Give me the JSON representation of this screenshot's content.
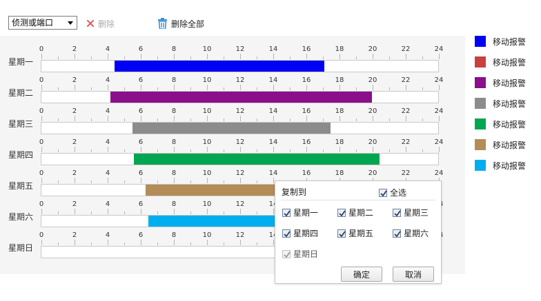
{
  "toolbar": {
    "select_value": "侦测或端口",
    "delete_label": "删除",
    "delete_all_label": "删除全部"
  },
  "axis_ticks": [
    "0",
    "2",
    "4",
    "6",
    "8",
    "10",
    "12",
    "14",
    "16",
    "18",
    "20",
    "22",
    "24"
  ],
  "days": [
    {
      "label": "星期一",
      "start": 4.4,
      "end": 17.1,
      "color": "#0000f5",
      "visible_ticks": 13
    },
    {
      "label": "星期二",
      "start": 4.15,
      "end": 19.95,
      "color": "#8b0e8b",
      "visible_ticks": 13
    },
    {
      "label": "星期三",
      "start": 5.5,
      "end": 17.45,
      "color": "#8c8c8c",
      "visible_ticks": 13
    },
    {
      "label": "星期四",
      "start": 5.6,
      "end": 20.4,
      "color": "#00a651",
      "visible_ticks": 13
    },
    {
      "label": "星期五",
      "start": 6.3,
      "end": 14.3,
      "color": "#b38c57",
      "visible_ticks": 13
    },
    {
      "label": "星期六",
      "start": 6.45,
      "end": 14.3,
      "color": "#00aeef",
      "visible_ticks": 13
    },
    {
      "label": "星期日",
      "start": null,
      "end": null,
      "color": null,
      "visible_ticks": 13
    }
  ],
  "legend": [
    {
      "label": "移动报警",
      "color": "#0000f5"
    },
    {
      "label": "移动报警",
      "color": "#c8403f"
    },
    {
      "label": "移动报警",
      "color": "#8b0e8b"
    },
    {
      "label": "移动报警",
      "color": "#8c8c8c"
    },
    {
      "label": "移动报警",
      "color": "#00a651"
    },
    {
      "label": "移动报警",
      "color": "#b38c57"
    },
    {
      "label": "移动报警",
      "color": "#00aeef"
    }
  ],
  "copy_popup": {
    "title": "复制到",
    "select_all": "全选",
    "days": [
      {
        "label": "星期一",
        "checked": true,
        "disabled": false
      },
      {
        "label": "星期二",
        "checked": true,
        "disabled": false
      },
      {
        "label": "星期三",
        "checked": true,
        "disabled": false
      },
      {
        "label": "星期四",
        "checked": true,
        "disabled": false
      },
      {
        "label": "星期五",
        "checked": true,
        "disabled": false
      },
      {
        "label": "星期六",
        "checked": true,
        "disabled": false
      },
      {
        "label": "星期日",
        "checked": true,
        "disabled": true
      }
    ],
    "ok_label": "确定",
    "cancel_label": "取消"
  }
}
